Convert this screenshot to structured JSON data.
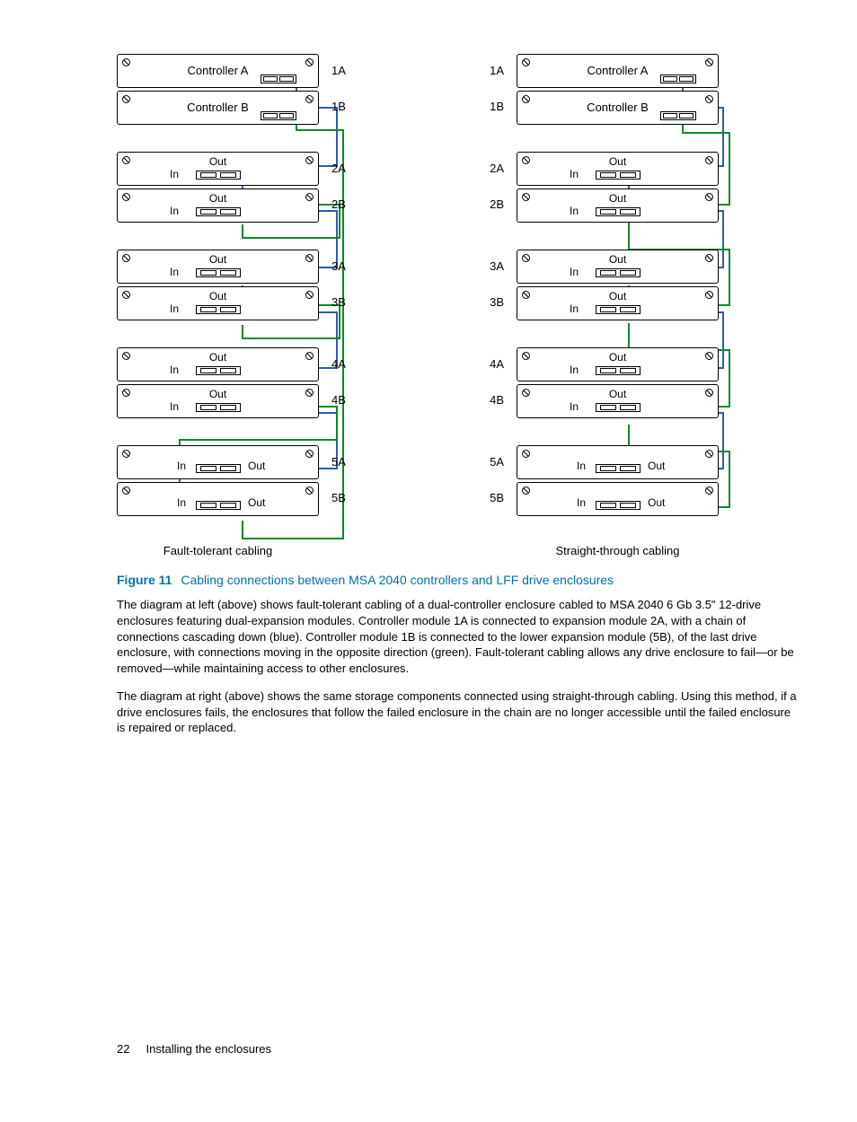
{
  "diagram": {
    "left_caption": "Fault-tolerant cabling",
    "right_caption": "Straight-through cabling",
    "labels": {
      "controller_a": "Controller A",
      "controller_b": "Controller B",
      "out": "Out",
      "in": "In"
    },
    "row_ids": [
      "1A",
      "1B",
      "2A",
      "2B",
      "3A",
      "3B",
      "4A",
      "4B",
      "5A",
      "5B"
    ]
  },
  "figure": {
    "label": "Figure 11",
    "caption": "Cabling connections between MSA 2040 controllers and LFF drive enclosures"
  },
  "para1": "The diagram at left (above) shows fault-tolerant cabling of a dual-controller enclosure cabled to MSA 2040 6 Gb 3.5\" 12-drive enclosures featuring dual-expansion modules. Controller module 1A is connected to expansion module 2A, with a chain of connections cascading down (blue). Controller module 1B is connected to the lower expansion module (5B), of the last drive enclosure, with connections moving in the opposite direction (green). Fault-tolerant cabling allows any drive enclosure to fail—or be removed—while maintaining access to other enclosures.",
  "para2": "The diagram at right (above) shows the same storage components connected using straight-through cabling. Using this method, if a drive enclosures fails, the enclosures that follow the failed enclosure in the chain are no longer accessible until the failed enclosure is repaired or replaced.",
  "footer": {
    "page": "22",
    "section": "Installing the enclosures"
  }
}
